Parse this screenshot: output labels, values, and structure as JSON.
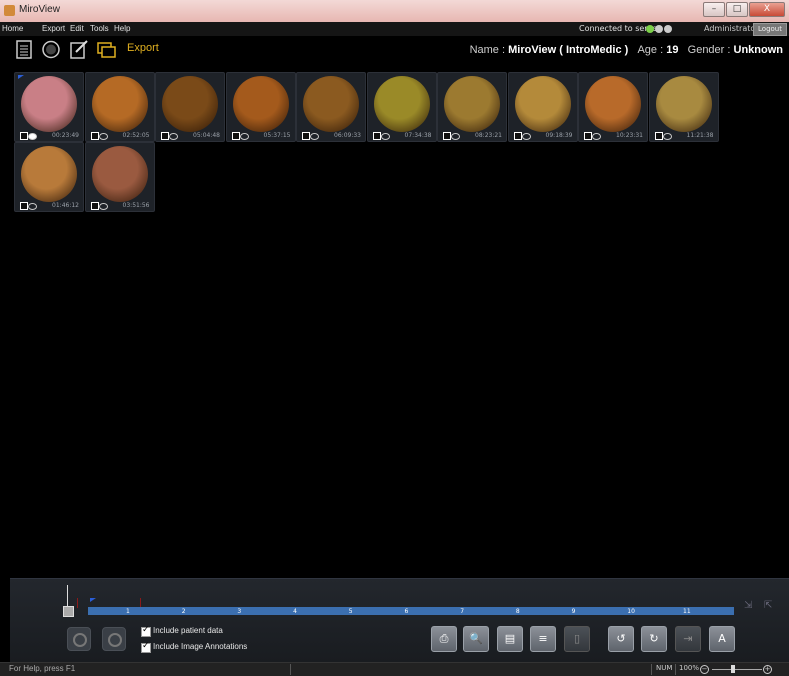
{
  "window": {
    "title": "MiroView",
    "min": "–",
    "max": "□",
    "close": "X"
  },
  "menu": [
    "Home",
    "Export",
    "Edit",
    "Tools",
    "Help"
  ],
  "server": {
    "status": "Connected to server",
    "user": "Administrator",
    "logout": "Logout"
  },
  "toolbar": {
    "export_label": "Export"
  },
  "patient": {
    "name_label": "Name : ",
    "name_value": "MiroView ( IntroMedic )",
    "age_label": "Age : ",
    "age_value": "19",
    "gender_label": "Gender : ",
    "gender_value": "Unknown"
  },
  "thumbnails": [
    {
      "time": "00:23:49",
      "color": "#c97f86",
      "flag": true,
      "note": true
    },
    {
      "time": "02:52:05",
      "color": "#b56a25",
      "flag": false,
      "note": false
    },
    {
      "time": "05:04:48",
      "color": "#7a4a18",
      "flag": false,
      "note": false
    },
    {
      "time": "05:37:15",
      "color": "#a45a1c",
      "flag": false,
      "note": false
    },
    {
      "time": "06:09:33",
      "color": "#8b5a20",
      "flag": false,
      "note": false
    },
    {
      "time": "07:34:38",
      "color": "#9a8a28",
      "flag": false,
      "note": false
    },
    {
      "time": "08:23:21",
      "color": "#9c7a30",
      "flag": false,
      "note": false
    },
    {
      "time": "09:18:39",
      "color": "#b48a3a",
      "flag": false,
      "note": false
    },
    {
      "time": "10:23:31",
      "color": "#b86a2a",
      "flag": false,
      "note": false
    },
    {
      "time": "11:21:38",
      "color": "#a88a40",
      "flag": false,
      "note": false
    },
    {
      "time": "01:46:12",
      "color": "#b87a3a",
      "flag": false,
      "note": false
    },
    {
      "time": "03:51:56",
      "color": "#9a5a40",
      "flag": false,
      "note": false
    }
  ],
  "timeline": {
    "ticks": [
      "1",
      "2",
      "3",
      "4",
      "5",
      "6",
      "7",
      "8",
      "9",
      "10",
      "11"
    ]
  },
  "options": {
    "include_patient": "Include patient data",
    "include_annotations": "Include Image Annotations"
  },
  "statusbar": {
    "help": "For Help, press F1",
    "num": "NUM",
    "zoom": "100%"
  }
}
